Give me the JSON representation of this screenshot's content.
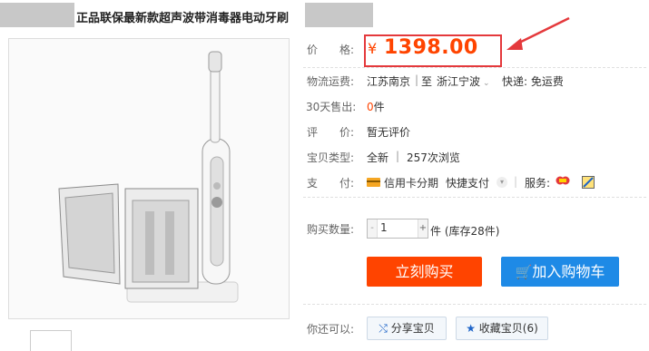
{
  "product": {
    "title": "正品联保最新款超声波带消毒器电动牙刷"
  },
  "price": {
    "label": "价　　格:",
    "currency": "¥",
    "value": "1398.00"
  },
  "shipping": {
    "label": "物流运费:",
    "from": "江苏南京",
    "separator": "|",
    "to_prefix": "至",
    "to": "浙江宁波",
    "express": "快递: 免运费"
  },
  "sales": {
    "label": "30天售出:",
    "count": "0",
    "unit": "件"
  },
  "review": {
    "label": "评　　价:",
    "value": "暂无评价"
  },
  "item_type": {
    "label": "宝贝类型:",
    "condition": "全新",
    "separator": "|",
    "views": "257次浏览"
  },
  "payment": {
    "label": "支　　付:",
    "installment": "信用卡分期",
    "quick_pay": "快捷支付",
    "service_label": "服务:"
  },
  "quantity": {
    "label": "购买数量:",
    "value": "1",
    "minus": "-",
    "plus": "+",
    "stock": "件 (库存28件)"
  },
  "actions": {
    "buy_now": "立刻购买",
    "add_to_cart": "加入购物车"
  },
  "share": {
    "label": "你还可以:",
    "share_item": "分享宝贝",
    "favorite_item": "收藏宝贝(6)"
  },
  "colors": {
    "accent": "#ff4400",
    "annotation": "#e4393c",
    "cart_blue": "#1e8ae6"
  }
}
